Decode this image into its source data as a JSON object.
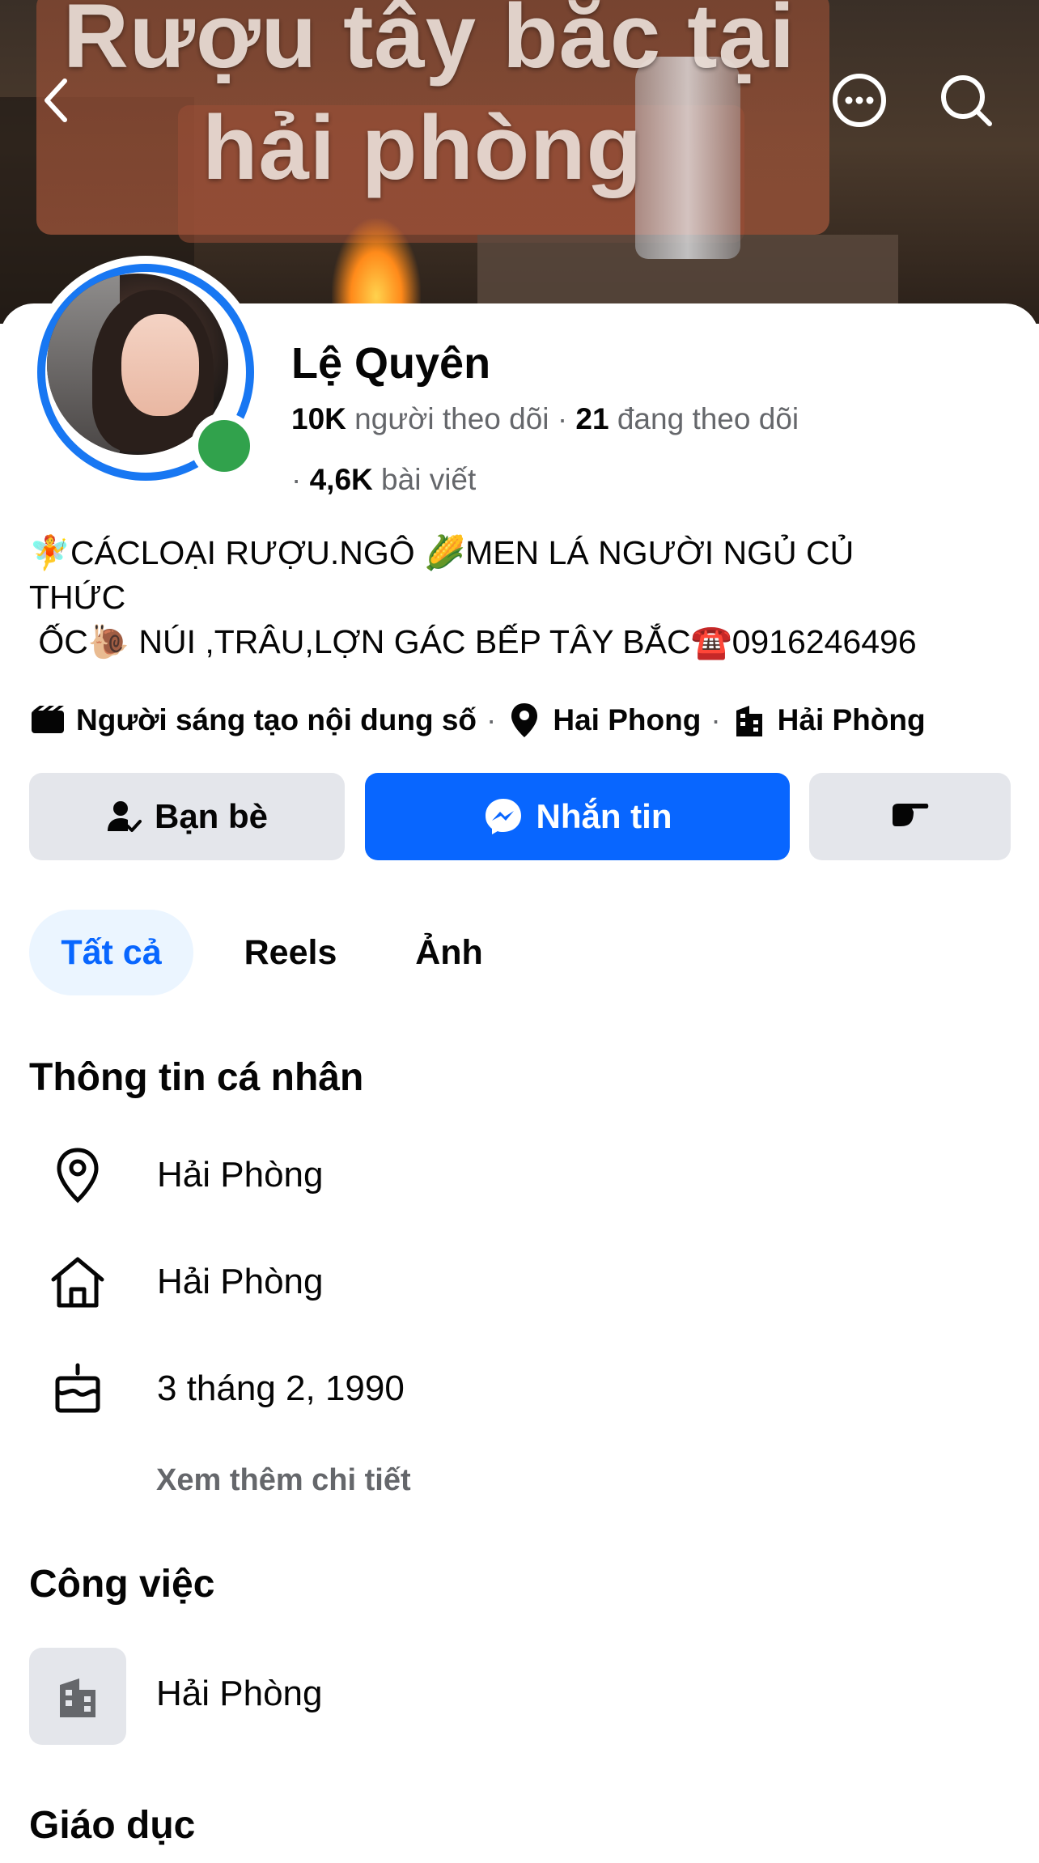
{
  "cover": {
    "text_line1": "Rượu tây bắc tại",
    "text_line2": "hải phòng"
  },
  "profile": {
    "name": "Lệ Quyên",
    "followers_count": "10K",
    "followers_label": "người theo dõi",
    "following_count": "21",
    "following_label": "đang theo dõi",
    "posts_count": "4,6K",
    "posts_label": "bài viết",
    "bio": "🧚CÁCLOẠI RƯỢU.NGÔ 🌽MEN LÁ NGƯỜI NGỦ CỦ\nTHỨC\n ỐC🐌 NÚI ,TRÂU,LỢN GÁC BẾP TÂY BẮC☎️0916246496",
    "category": "Người sáng tạo nội dung số",
    "location": "Hai Phong",
    "workplace": "Hải Phòng"
  },
  "actions": {
    "friends_label": "Bạn bè",
    "message_label": "Nhắn tin"
  },
  "tabs": [
    {
      "label": "Tất cả"
    },
    {
      "label": "Reels"
    },
    {
      "label": "Ảnh"
    }
  ],
  "personal_info": {
    "title": "Thông tin cá nhân",
    "current_city": "Hải Phòng",
    "hometown": "Hải Phòng",
    "birthday": "3 tháng 2, 1990",
    "see_more": "Xem thêm chi tiết"
  },
  "work": {
    "title": "Công việc",
    "place": "Hải Phòng"
  },
  "education": {
    "title": "Giáo dục"
  },
  "colors": {
    "accent": "#0866ff",
    "online": "#31a24c",
    "ring": "#1877f2",
    "button_gray": "#e4e6eb",
    "secondary_text": "#65676b"
  },
  "icons": {
    "back": "chevron-left-icon",
    "more": "more-icon",
    "search": "search-icon",
    "category": "clapper-icon",
    "location": "pin-icon",
    "workplace": "building-icon",
    "friends": "friend-check-icon",
    "messenger": "messenger-icon",
    "poke": "poke-icon",
    "home": "home-icon",
    "birthday": "cake-icon"
  }
}
